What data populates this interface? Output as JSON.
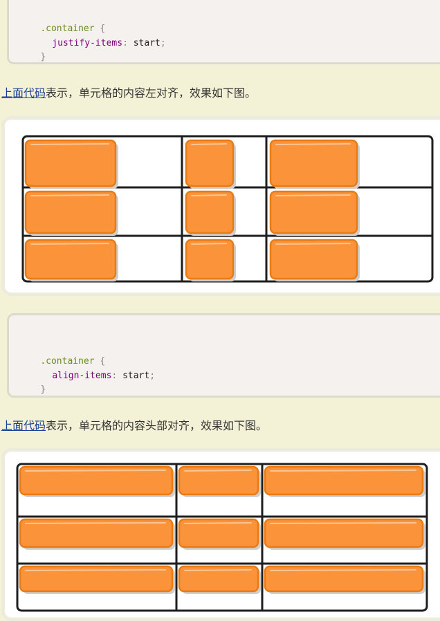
{
  "blocks": [
    {
      "code": {
        "selector": ".container",
        "open_brace": "{",
        "property": "justify-items",
        "colon": ":",
        "value": "start",
        "semicolon": ";",
        "close_brace": "}"
      },
      "para": {
        "link": "上面代码",
        "text": "表示，单元格的内容左对齐，效果如下图。"
      },
      "figure": {
        "mode": "justify-start"
      }
    },
    {
      "code": {
        "selector": ".container",
        "open_brace": "{",
        "property": "align-items",
        "colon": ":",
        "value": "start",
        "semicolon": ";",
        "close_brace": "}"
      },
      "para": {
        "link": "上面代码",
        "text": "表示，单元格的内容头部对齐，效果如下图。"
      },
      "figure": {
        "mode": "align-start"
      }
    }
  ],
  "colors": {
    "page_bg": "#f4f2d6",
    "code_bg": "#f4f1ef",
    "item_fill": "#fb933a",
    "item_stroke": "#e97b14",
    "grid_line": "#1e1e1e",
    "link": "#1a3f9a"
  }
}
